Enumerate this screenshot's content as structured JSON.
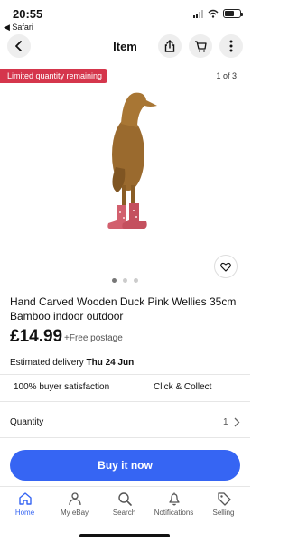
{
  "status_bar": {
    "time": "20:55",
    "back_app": "◀ Safari"
  },
  "nav": {
    "title": "Item"
  },
  "listing": {
    "badge": "Limited quantity remaining",
    "image_counter": "1 of 3",
    "images_total": 3,
    "active_image": 1,
    "title": "Hand Carved Wooden Duck Pink Wellies 35cm Bamboo indoor outdoor",
    "price": "£14.99",
    "postage": "+Free postage",
    "delivery_label": "Estimated delivery",
    "delivery_date": "Thu 24 Jun",
    "features": [
      "100% buyer satisfaction",
      "Click & Collect"
    ],
    "quantity_label": "Quantity",
    "quantity_value": "1",
    "buy_button": "Buy it now"
  },
  "tabs": [
    {
      "label": "Home",
      "icon": "home-icon",
      "active": true
    },
    {
      "label": "My eBay",
      "icon": "person-icon",
      "active": false
    },
    {
      "label": "Search",
      "icon": "search-icon",
      "active": false
    },
    {
      "label": "Notifications",
      "icon": "bell-icon",
      "active": false
    },
    {
      "label": "Selling",
      "icon": "tag-icon",
      "active": false
    }
  ],
  "colors": {
    "accent": "#3665f3",
    "badge": "#d5364c"
  }
}
